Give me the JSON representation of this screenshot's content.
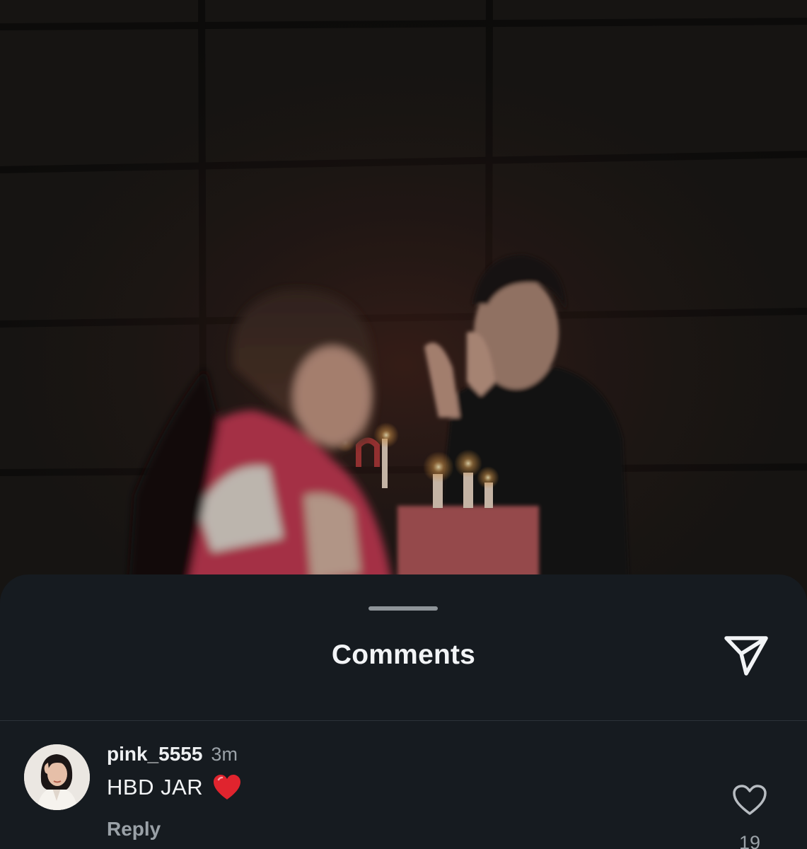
{
  "sheet": {
    "title": "Comments"
  },
  "comments": [
    {
      "username": "pink_5555",
      "time": "3m",
      "text": "HBD JAR",
      "emoji": "❤️",
      "reply_label": "Reply",
      "like_count": "19"
    }
  ],
  "icons": {
    "share": "send-icon",
    "like": "heart-outline-icon",
    "emoji": "red-heart-icon",
    "grabber": "drag-handle"
  },
  "colors": {
    "sheet_bg": "#161b20",
    "primary_text": "#f2f4f6",
    "secondary_text": "#9aa1a7",
    "heart_red": "#e0242e"
  }
}
